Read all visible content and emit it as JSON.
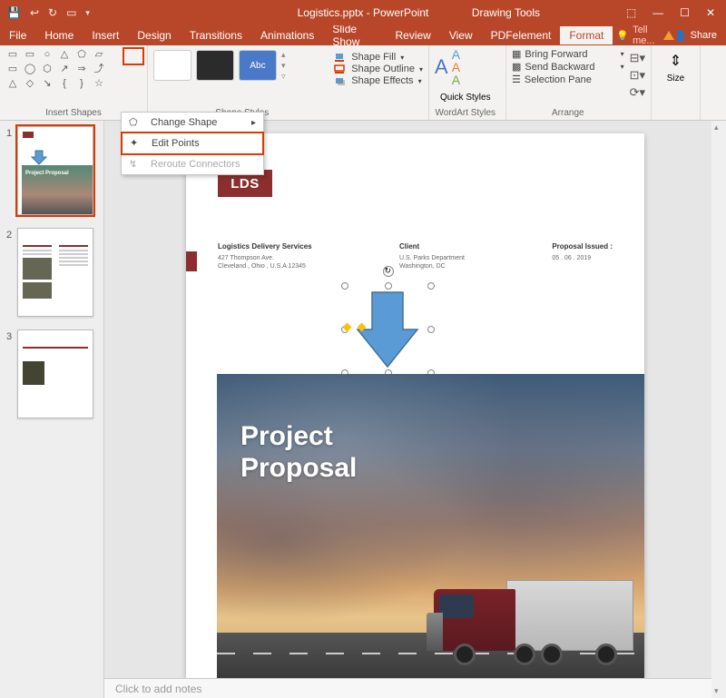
{
  "titlebar": {
    "title": "Logistics.pptx - PowerPoint",
    "context_tab": "Drawing Tools"
  },
  "tabs": {
    "file": "File",
    "home": "Home",
    "insert": "Insert",
    "design": "Design",
    "transitions": "Transitions",
    "animations": "Animations",
    "slideshow": "Slide Show",
    "review": "Review",
    "view": "View",
    "pdfelement": "PDFelement",
    "format": "Format",
    "tellme": "Tell me...",
    "share": "Share"
  },
  "ribbon": {
    "insert_shapes": "Insert Shapes",
    "shape_styles": "Shape Styles",
    "abc": "Abc",
    "shape_fill": "Shape Fill",
    "shape_outline": "Shape Outline",
    "shape_effects": "Shape Effects",
    "wordart_styles": "WordArt Styles",
    "quick_styles": "Quick\nStyles",
    "arrange": "Arrange",
    "bring_forward": "Bring Forward",
    "send_backward": "Send Backward",
    "selection_pane": "Selection Pane",
    "size": "Size"
  },
  "dropdown": {
    "change_shape": "Change Shape",
    "edit_points": "Edit Points",
    "reroute": "Reroute Connectors"
  },
  "slide": {
    "logo": "LDS",
    "company": "Logistics Delivery Services",
    "addr1": "427 Thompson Ave.",
    "addr2": "Cleveland , Ohio , U.S.A 12345",
    "client_lbl": "Client",
    "client1": "U.S. Parks Department",
    "client2": "Washington, DC",
    "issued_lbl": "Proposal Issued :",
    "issued_date": "05 . 06 . 2019",
    "hero_title_1": "Project",
    "hero_title_2": "Proposal"
  },
  "thumbs": {
    "t1": "1",
    "t2": "2",
    "t3": "3",
    "t1_title": "Project\nProposal"
  },
  "notes": {
    "placeholder": "Click to add notes"
  }
}
